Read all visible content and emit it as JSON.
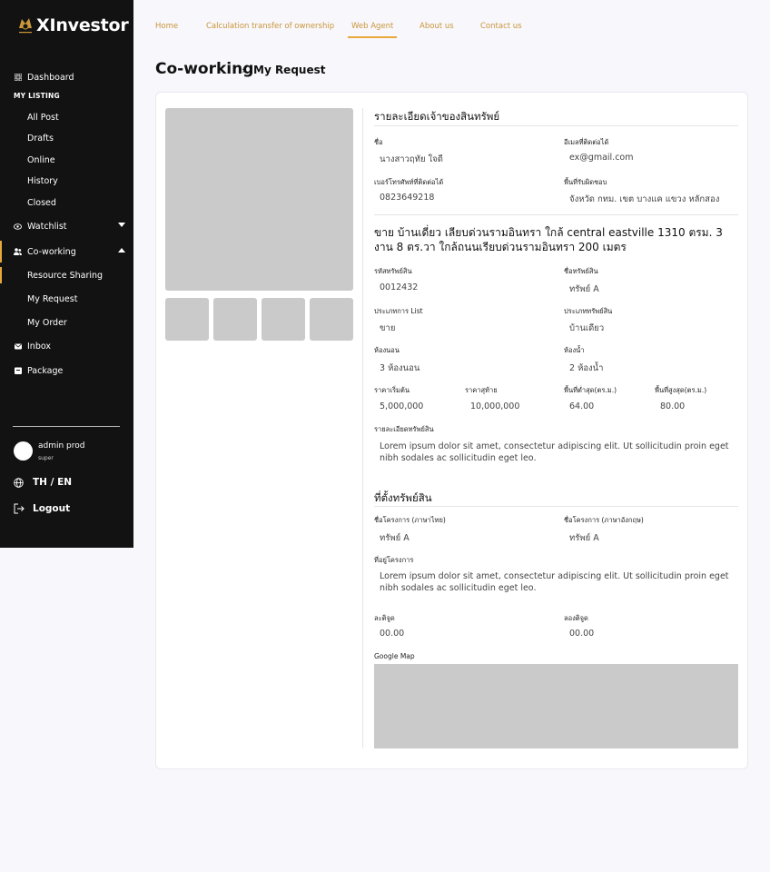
{
  "app": {
    "name": "XInvestor"
  },
  "topnav": {
    "items": [
      "Home",
      "Calculation transfer of ownership",
      "Web Agent",
      "About us",
      "Contact us"
    ],
    "active": "Web Agent"
  },
  "sidebar": {
    "dashboard": "Dashboard",
    "section_label": "MY LISTING",
    "listing_items": [
      "All Post",
      "Drafts",
      "Online",
      "History",
      "Closed"
    ],
    "watchlist": "Watchlist",
    "coworking": "Co-working",
    "coworking_items": [
      "Resource Sharing",
      "My Request",
      "My Order"
    ],
    "inbox": "Inbox",
    "package": "Package",
    "user": {
      "name": "admin prod",
      "role": "super"
    },
    "language": "TH / EN",
    "logout": "Logout"
  },
  "page": {
    "title": "Co-working",
    "breadcrumb_sep": "›",
    "breadcrumb": "My Request"
  },
  "owner": {
    "section_title": "รายละเอียดเจ้าของสินทรัพย์",
    "name_label": "ชื่อ",
    "name_value": "นางสาวฤทัย ใจดี",
    "email_label": "อีเมลที่ติดต่อได้",
    "email_value": "ex@gmail.com",
    "phone_label": "เบอร์โทรศัพท์ที่ติดต่อได้",
    "phone_value": "0823649218",
    "area_label": "พื้นที่รับผิดชอบ",
    "area_value": "จังหวัด กทม.  เขต บางแค  แขวง หลักสอง"
  },
  "listing": {
    "title": "ขาย บ้านเดี่ยว เลียบด่วนรามอินทรา ใกล้ central eastville 1310 ตรม. 3 งาน 8 ตร.วา ใกล้ถนนเรียบด่วนรามอินทรา 200 เมตร",
    "code_label": "รหัสทรัพย์สิน",
    "code_value": "0012432",
    "asset_name_label": "ชื่อทรัพย์สิน",
    "asset_name_value": "ทรัพย์ A",
    "list_type_label": "ประเภทการ List",
    "list_type_value": "ขาย",
    "asset_type_label": "ประเภททรัพย์สิน",
    "asset_type_value": "บ้านเดียว",
    "bedroom_label": "ห้องนอน",
    "bedroom_value": "3 ห้องนอน",
    "bathroom_label": "ห้องน้ำ",
    "bathroom_value": "2 ห้องน้ำ",
    "price_start_label": "ราคาเริ่มต้น",
    "price_start_value": "5,000,000",
    "price_end_label": "ราคาสุท้าย",
    "price_end_value": "10,000,000",
    "area_min_label": "พื้นที่ต่ำสุด(ตร.ม.)",
    "area_min_value": "64.00",
    "area_max_label": "พื้นที่สูงสุด(ตร.ม.)",
    "area_max_value": "80.00",
    "detail_label": "รายละเอียดทรัพย์สิน",
    "detail_value": "Lorem ipsum dolor sit amet, consectetur adipiscing elit. Ut sollicitudin proin eget nibh sodales ac sollicitudin eget leo."
  },
  "location": {
    "section_title": "ที่ตั้งทรัพย์สิน",
    "project_th_label": "ชื่อโครงการ (ภาษาไทย)",
    "project_th_value": "ทรัพย์ A",
    "project_en_label": "ชื่อโครงการ (ภาษาอังกฤษ)",
    "project_en_value": "ทรัพย์ A",
    "address_label": "ที่อยู่โครงการ",
    "address_value": "Lorem ipsum dolor sit amet, consectetur adipiscing elit. Ut sollicitudin proin eget nibh sodales ac sollicitudin eget leo.",
    "lat_label": "ละติจูด",
    "lat_value": "00.00",
    "lng_label": "ลองติจูด",
    "lng_value": "00.00",
    "map_label": "Google Map"
  },
  "colors": {
    "accent": "#e8a93a",
    "sidebar_bg": "#121212",
    "placeholder": "#cacaca"
  }
}
